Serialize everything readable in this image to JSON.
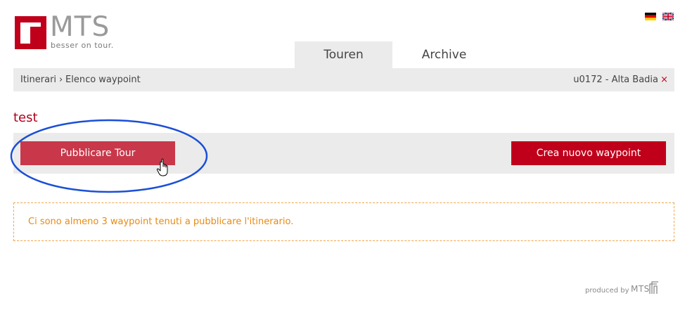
{
  "brand": {
    "name": "MTS",
    "tagline": "besser on tour.",
    "colors": {
      "primary": "#c0001a",
      "accent_light": "#c8384a",
      "notice": "#e88a12",
      "annotation": "#1a4fd6"
    }
  },
  "languages": [
    {
      "code": "de",
      "icon": "flag-germany-icon"
    },
    {
      "code": "en",
      "icon": "flag-uk-icon"
    }
  ],
  "tabs": [
    {
      "label": "Touren",
      "active": true
    },
    {
      "label": "Archive",
      "active": false
    }
  ],
  "breadcrumb": {
    "items": [
      "Itinerari",
      "Elenco waypoint"
    ],
    "separator": "›",
    "station": "u0172 - Alta Badia",
    "close_symbol": "×"
  },
  "page": {
    "title": "test"
  },
  "actions": {
    "publish_label": "Pubblicare Tour",
    "create_label": "Crea nuovo waypoint"
  },
  "notice": {
    "text": "Ci sono almeno 3 waypoint tenuti a pubblicare l'itinerario."
  },
  "footer": {
    "label": "produced by",
    "logo_text": "MTS"
  }
}
